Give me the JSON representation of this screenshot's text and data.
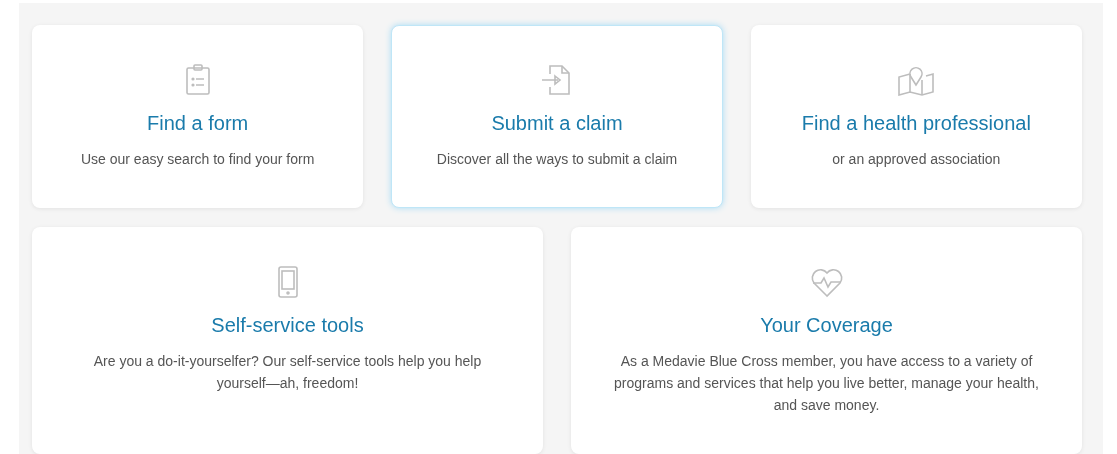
{
  "cards": [
    {
      "kind": "clipboard",
      "title": "Find a form",
      "description": "Use our easy search to find your form",
      "selected": false
    },
    {
      "kind": "file-arrow",
      "title": "Submit a claim",
      "description": "Discover all the ways to submit a claim",
      "selected": true
    },
    {
      "kind": "map",
      "title": "Find a health professional",
      "description": "or an approved association",
      "selected": false
    },
    {
      "kind": "phone",
      "title": "Self-service tools",
      "description": "Are you a do-it-yourselfer? Our self-service tools help you help yourself—ah, freedom!",
      "selected": false
    },
    {
      "kind": "heart",
      "title": "Your Coverage",
      "description": "As a Medavie Blue Cross member, you have access to a variety of programs and services that help you live better, manage your health, and save money.",
      "selected": false
    }
  ]
}
